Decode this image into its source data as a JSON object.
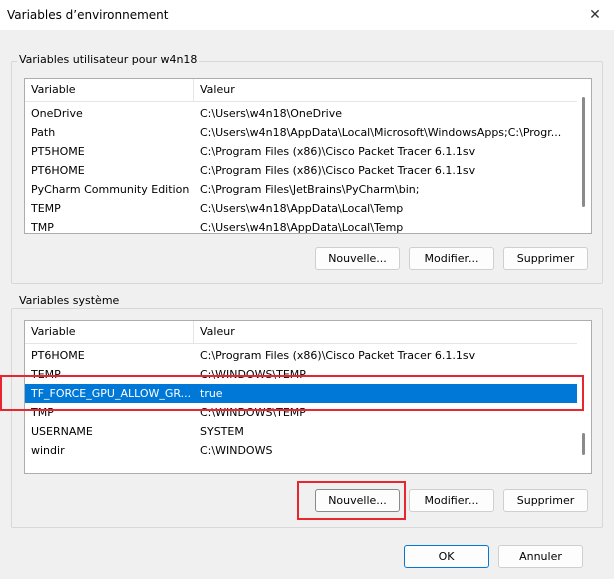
{
  "window": {
    "title": "Variables d’environnement"
  },
  "user_group": {
    "label": "Variables utilisateur pour w4n18",
    "columns": [
      "Variable",
      "Valeur"
    ],
    "rows": [
      {
        "name": "OneDrive",
        "value": "C:\\Users\\w4n18\\OneDrive"
      },
      {
        "name": "Path",
        "value": "C:\\Users\\w4n18\\AppData\\Local\\Microsoft\\WindowsApps;C:\\Progr..."
      },
      {
        "name": "PT5HOME",
        "value": "C:\\Program Files (x86)\\Cisco Packet Tracer 6.1.1sv"
      },
      {
        "name": "PT6HOME",
        "value": "C:\\Program Files (x86)\\Cisco Packet Tracer 6.1.1sv"
      },
      {
        "name": "PyCharm Community Edition",
        "value": "C:\\Program Files\\JetBrains\\PyCharm\\bin;"
      },
      {
        "name": "TEMP",
        "value": "C:\\Users\\w4n18\\AppData\\Local\\Temp"
      },
      {
        "name": "TMP",
        "value": "C:\\Users\\w4n18\\AppData\\Local\\Temp"
      }
    ],
    "buttons": {
      "new": "Nouvelle...",
      "edit": "Modifier...",
      "delete": "Supprimer"
    }
  },
  "system_group": {
    "label": "Variables système",
    "columns": [
      "Variable",
      "Valeur"
    ],
    "rows": [
      {
        "name": "PT6HOME",
        "value": "C:\\Program Files (x86)\\Cisco Packet Tracer 6.1.1sv"
      },
      {
        "name": "TEMP",
        "value": "C:\\WINDOWS\\TEMP"
      },
      {
        "name": "TF_FORCE_GPU_ALLOW_GR...",
        "value": "true"
      },
      {
        "name": "TMP",
        "value": "C:\\WINDOWS\\TEMP"
      },
      {
        "name": "USERNAME",
        "value": "SYSTEM"
      },
      {
        "name": "windir",
        "value": "C:\\WINDOWS"
      }
    ],
    "buttons": {
      "new": "Nouvelle...",
      "edit": "Modifier...",
      "delete": "Supprimer"
    }
  },
  "footer": {
    "ok": "OK",
    "cancel": "Annuler"
  },
  "colors": {
    "selection": "#0078d7",
    "highlight_box": "#e8262f"
  },
  "icons": {
    "close": "close-icon"
  }
}
